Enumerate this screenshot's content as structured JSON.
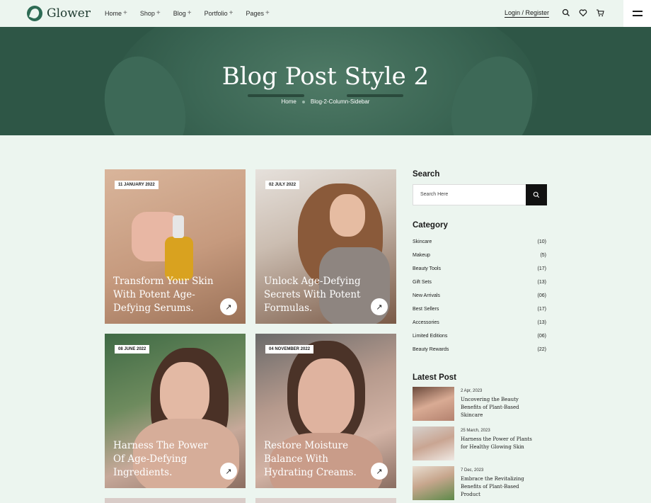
{
  "header": {
    "logo_text": "Glower",
    "nav": [
      {
        "label": "Home",
        "plus": "+"
      },
      {
        "label": "Shop",
        "plus": "+"
      },
      {
        "label": "Blog",
        "plus": "+"
      },
      {
        "label": "Portfolio",
        "plus": "+"
      },
      {
        "label": "Pages",
        "plus": "+"
      }
    ],
    "login_label": "Login / Register"
  },
  "hero": {
    "title": "Blog Post Style 2",
    "breadcrumb": [
      "Home",
      "Blog-2-Column-Sidebar"
    ]
  },
  "posts": [
    {
      "date": "11 JANUARY 2022",
      "title": "Transform Your Skin With Potent Age-Defying Serums.",
      "arrow": "↗"
    },
    {
      "date": "02 JULY 2022",
      "title": "Unlock Age-Defying Secrets With Potent Formulas.",
      "arrow": "↗"
    },
    {
      "date": "08 JUNE 2022",
      "title": "Harness The Power Of Age-Defying Ingredients.",
      "arrow": "↗"
    },
    {
      "date": "04 NOVEMBER 2022",
      "title": "Restore Moisture Balance With Hydrating Creams.",
      "arrow": "↗"
    }
  ],
  "sidebar": {
    "search_heading": "Search",
    "search_placeholder": "Search Here",
    "category_heading": "Category",
    "categories": [
      {
        "name": "Skincare",
        "count": "(10)"
      },
      {
        "name": "Makeup",
        "count": "(5)"
      },
      {
        "name": "Beauty Tools",
        "count": "(17)"
      },
      {
        "name": "Gift Sets",
        "count": "(13)"
      },
      {
        "name": "New Arrivals",
        "count": "(06)"
      },
      {
        "name": "Best Sellers",
        "count": "(17)"
      },
      {
        "name": "Accessories",
        "count": "(13)"
      },
      {
        "name": "Limited Editions",
        "count": "(06)"
      },
      {
        "name": "Beauty Rewards",
        "count": "(22)"
      }
    ],
    "latest_heading": "Latest Post",
    "latest_posts": [
      {
        "date": "2 Apr, 2023",
        "title": "Uncovering the Beauty Benefits of Plant-Based Skincare"
      },
      {
        "date": "25 March, 2023",
        "title": "Harness the Power of Plants for Healthy Glowing Skin"
      },
      {
        "date": "7 Dec, 2023",
        "title": "Embrace the Revitalizing Benefits of Plant-Based Product"
      }
    ]
  },
  "colors": {
    "page_bg": "#ecf5ef",
    "hero_bg": "#2e5646",
    "brand": "#2d6b54",
    "search_button": "#111111"
  },
  "icons": [
    "logo-leaf-icon",
    "search-icon",
    "heart-icon",
    "cart-icon",
    "hamburger-menu-icon",
    "arrow-up-right-icon"
  ]
}
